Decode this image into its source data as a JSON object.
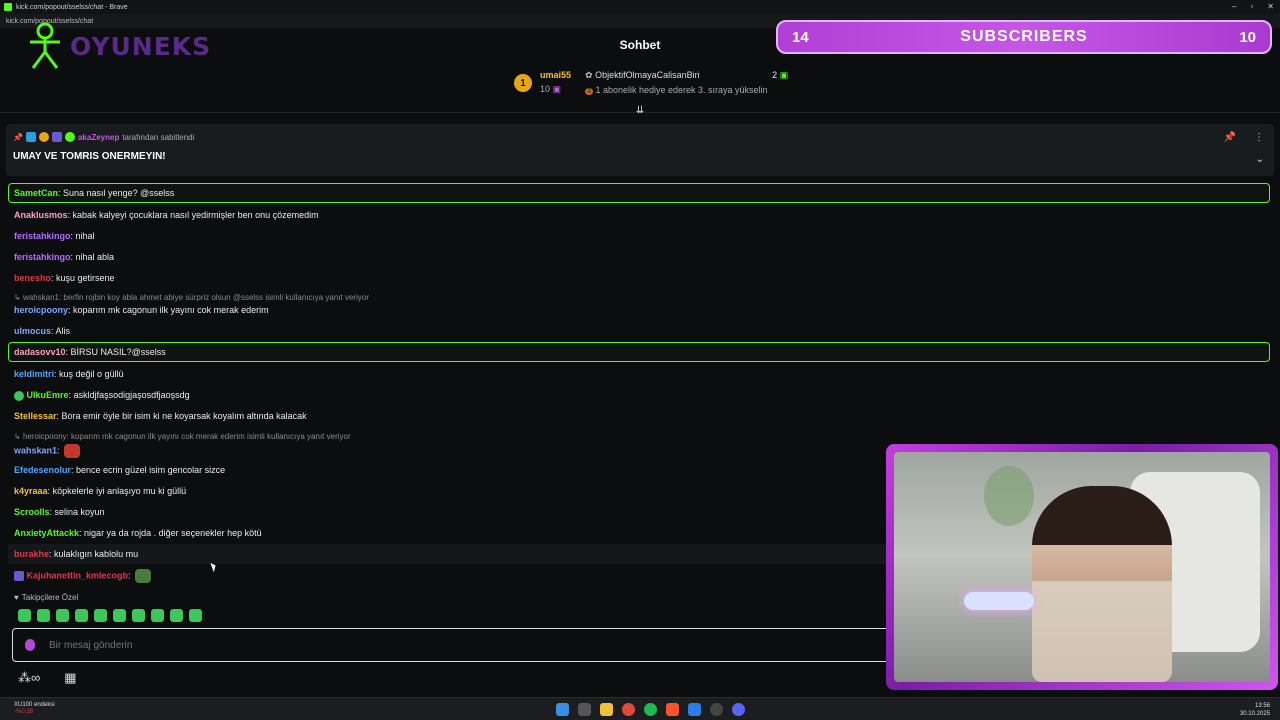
{
  "browser": {
    "window_title": "kick.com/popout/sselss/chat - Brave",
    "address": "kick.com/popout/sselss/chat"
  },
  "chat": {
    "title": "Sohbet"
  },
  "logo": {
    "text": "OYUNEKS"
  },
  "subscribers_widget": {
    "left": "14",
    "label": "SUBSCRIBERS",
    "right": "10"
  },
  "leaderboard": {
    "rank": "1",
    "top_user": "umai55",
    "top_count": "10",
    "second_user": "ObjektifOlmayaCalisanBiri",
    "second_count": "2",
    "hint_rank": "3",
    "hint": "1 abonelik hediye ederek 3. sıraya yükselin"
  },
  "pinned": {
    "pinned_by": "akaZeynep",
    "pinned_suffix": "tarafından sabitlendi",
    "message": "UMAY VE TOMRIS ONERMEYIN!"
  },
  "messages": [
    {
      "user": "SametCan",
      "color": "#53fc18",
      "text": "Suna nasıl yenge? @sselss"
    },
    {
      "user": "Anaklusmos",
      "color": "#ff9ec4",
      "text": "kabak kalyeyi çocuklara nasıl yedirmişler ben onu çözemedim"
    },
    {
      "user": "feristahkingo",
      "color": "#b46bff",
      "text": "nihal"
    },
    {
      "user": "feristahkingo",
      "color": "#b46bff",
      "text": "nihal abla"
    },
    {
      "user": "benesho",
      "color": "#e0364a",
      "text": "kuşu getirsene"
    },
    {
      "reply": "wahskan1: berfin rojbin koy abla ahmet abiye sürpriz olsun @sselss isimli kullanıcıya yanıt veriyor"
    },
    {
      "user": "heroicpoony",
      "color": "#7aa7ff",
      "text": "koparım mk cagonun ilk yayını cok merak ederim"
    },
    {
      "user": "ulmocus",
      "color": "#7aa7ff",
      "text": "Alis"
    },
    {
      "user": "dadasovv10",
      "color": "#ff9ec4",
      "text": "BİRSU NASIL?@sselss"
    },
    {
      "user": "keldimitri",
      "color": "#4aa8ff",
      "text": "kuş değil o güllü"
    },
    {
      "user": "UlkuEmre",
      "color": "#53fc18",
      "text": "askldjfaşsodigjaşosdfjaoşsdg"
    },
    {
      "user": "Stellessar",
      "color": "#f5c12b",
      "text": "Bora emir öyle bir isim ki ne koyarsak koyalım altında kalacak"
    },
    {
      "reply": "heroicpoony: koparım mk cagonun ilk yayını cok merak ederim isimli kullanıcıya yanıt veriyor"
    },
    {
      "user": "wahskan1",
      "color": "#7aa7ff",
      "text": ""
    },
    {
      "user": "Efedesenolur",
      "color": "#4aa8ff",
      "text": "bence ecrin güzel isim gencolar sizce"
    },
    {
      "user": "k4yraaa",
      "color": "#f5c12b",
      "text": "köpkelerle iyi anlaşıyo mu ki güllü"
    },
    {
      "user": "Scroolls",
      "color": "#53fc18",
      "text": "selina koyun"
    },
    {
      "user": "AnxietyAttackk",
      "color": "#53fc18",
      "text": "nigar ya da rojda . diğer seçenekler hep kötü"
    },
    {
      "user": "burakhe",
      "color": "#e0364a",
      "text": "kulaklıgın kablolu mu"
    },
    {
      "user": "Kajuhanettin_kmlecogb",
      "color": "#e0364a",
      "text": ""
    }
  ],
  "followers_label": "Takipçilere Özel",
  "input": {
    "placeholder": "Bir mesaj gönderin"
  },
  "taskbar": {
    "ticker_name": "XU100 endeksi",
    "ticker_value": "-%0,28",
    "time": "13:56",
    "date": "30.10.2025"
  },
  "colors": {
    "kick_green": "#53fc18",
    "accent_purple": "#c457e6",
    "gold": "#f5c12b"
  }
}
